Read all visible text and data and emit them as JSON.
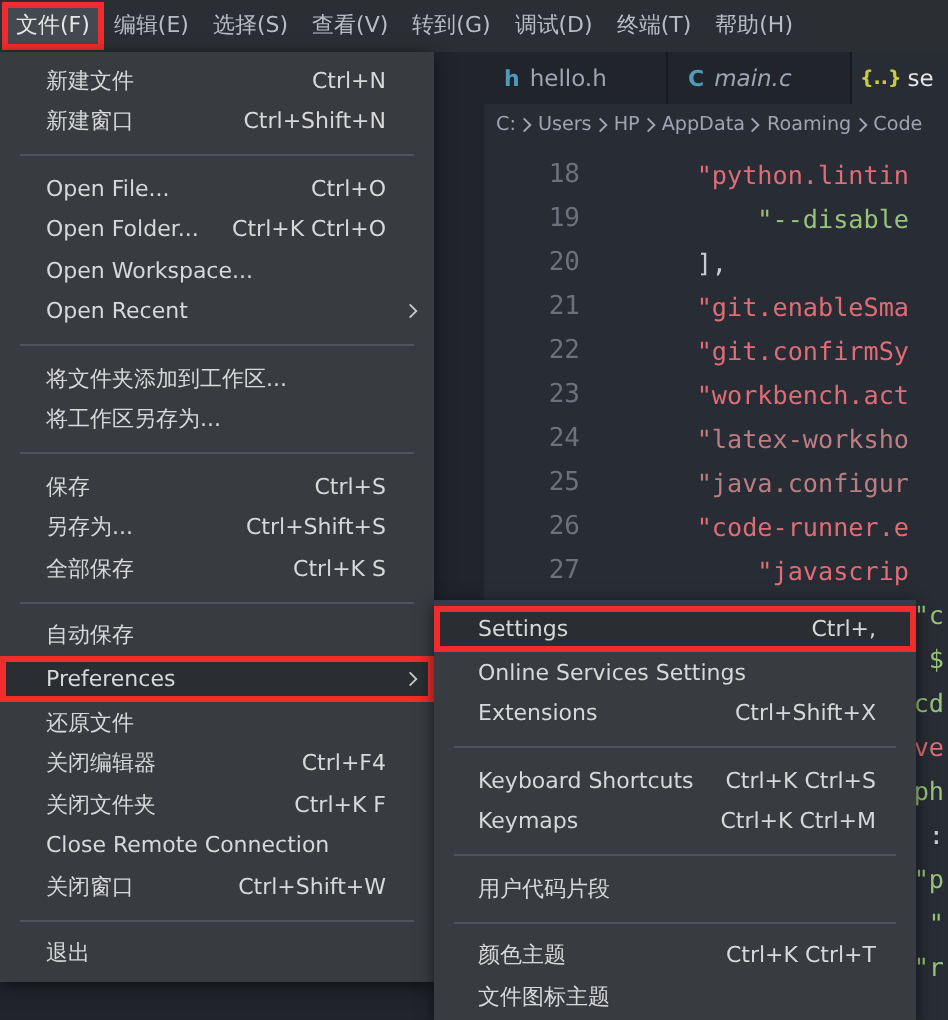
{
  "menubar": [
    {
      "label": "文件(F)",
      "selected": true,
      "annotated": true
    },
    {
      "label": "编辑(E)",
      "selected": false,
      "annotated": false
    },
    {
      "label": "选择(S)",
      "selected": false,
      "annotated": false
    },
    {
      "label": "查看(V)",
      "selected": false,
      "annotated": false
    },
    {
      "label": "转到(G)",
      "selected": false,
      "annotated": false
    },
    {
      "label": "调试(D)",
      "selected": false,
      "annotated": false
    },
    {
      "label": "终端(T)",
      "selected": false,
      "annotated": false
    },
    {
      "label": "帮助(H)",
      "selected": false,
      "annotated": false
    }
  ],
  "tabs": [
    {
      "label": "hello.h",
      "icon": "h",
      "kind": "header",
      "italic": false,
      "selected": false
    },
    {
      "label": "main.c",
      "icon": "C",
      "kind": "c",
      "italic": true,
      "selected": false
    },
    {
      "label": "se",
      "icon": "{..}",
      "kind": "json",
      "italic": false,
      "selected": true
    }
  ],
  "breadcrumb": [
    "C:",
    "Users",
    "HP",
    "AppData",
    "Roaming",
    "Code"
  ],
  "code_lines": [
    {
      "number": "18",
      "text": "    \"python.lintin",
      "kind": "key",
      "covered": false
    },
    {
      "number": "19",
      "text": "        \"--disable",
      "kind": "value",
      "covered": false
    },
    {
      "number": "20",
      "text": "    ],",
      "kind": "punct",
      "covered": false
    },
    {
      "number": "21",
      "text": "    \"git.enableSma",
      "kind": "key",
      "covered": false
    },
    {
      "number": "22",
      "text": "    \"git.confirmSy",
      "kind": "key",
      "covered": false
    },
    {
      "number": "23",
      "text": "    \"workbench.act",
      "kind": "key",
      "covered": false
    },
    {
      "number": "24",
      "text": "    \"latex-worksho",
      "kind": "dim",
      "covered": false
    },
    {
      "number": "25",
      "text": "    \"java.configur",
      "kind": "dim",
      "covered": false
    },
    {
      "number": "26",
      "text": "    \"code-runner.e",
      "kind": "key",
      "covered": false
    },
    {
      "number": "27",
      "text": "        \"javascrip",
      "kind": "key",
      "covered": false
    },
    {
      "text": "\"c",
      "kind": "value",
      "covered": true
    },
    {
      "text": "$",
      "kind": "value",
      "covered": true
    },
    {
      "text": "cd",
      "kind": "value",
      "covered": true
    },
    {
      "text": "ve",
      "kind": "key",
      "covered": true
    },
    {
      "text": "ph",
      "kind": "value",
      "covered": true
    },
    {
      "text": ":",
      "kind": "punct",
      "covered": true
    },
    {
      "text": "\"p",
      "kind": "value",
      "covered": true
    },
    {
      "text": "\"",
      "kind": "value",
      "covered": true
    },
    {
      "text": "\"r",
      "kind": "value",
      "covered": true
    }
  ],
  "file_menu": [
    [
      {
        "label": "新建文件",
        "shortcut": "Ctrl+N"
      },
      {
        "label": "新建窗口",
        "shortcut": "Ctrl+Shift+N"
      }
    ],
    [
      {
        "label": "Open File...",
        "shortcut": "Ctrl+O"
      },
      {
        "label": "Open Folder...",
        "shortcut": "Ctrl+K Ctrl+O"
      },
      {
        "label": "Open Workspace..."
      },
      {
        "label": "Open Recent",
        "submenu": true
      }
    ],
    [
      {
        "label": "将文件夹添加到工作区..."
      },
      {
        "label": "将工作区另存为..."
      }
    ],
    [
      {
        "label": "保存",
        "shortcut": "Ctrl+S"
      },
      {
        "label": "另存为...",
        "shortcut": "Ctrl+Shift+S"
      },
      {
        "label": "全部保存",
        "shortcut": "Ctrl+K S"
      }
    ],
    [
      {
        "label": "自动保存"
      },
      {
        "label": "Preferences",
        "submenu": true,
        "selected": true,
        "annotated": true
      },
      {
        "label": "还原文件"
      },
      {
        "label": "关闭编辑器",
        "shortcut": "Ctrl+F4"
      },
      {
        "label": "关闭文件夹",
        "shortcut": "Ctrl+K F"
      },
      {
        "label": "Close Remote Connection"
      },
      {
        "label": "关闭窗口",
        "shortcut": "Ctrl+Shift+W"
      }
    ],
    [
      {
        "label": "退出"
      }
    ]
  ],
  "preferences_menu": [
    [
      {
        "label": "Settings",
        "shortcut": "Ctrl+,",
        "selected": true,
        "annotated": true
      },
      {
        "label": "Online Services Settings"
      },
      {
        "label": "Extensions",
        "shortcut": "Ctrl+Shift+X"
      }
    ],
    [
      {
        "label": "Keyboard Shortcuts",
        "shortcut": "Ctrl+K Ctrl+S"
      },
      {
        "label": "Keymaps",
        "shortcut": "Ctrl+K Ctrl+M"
      }
    ],
    [
      {
        "label": "用户代码片段"
      }
    ],
    [
      {
        "label": "颜色主题",
        "shortcut": "Ctrl+K Ctrl+T"
      },
      {
        "label": "文件图标主题"
      }
    ]
  ]
}
